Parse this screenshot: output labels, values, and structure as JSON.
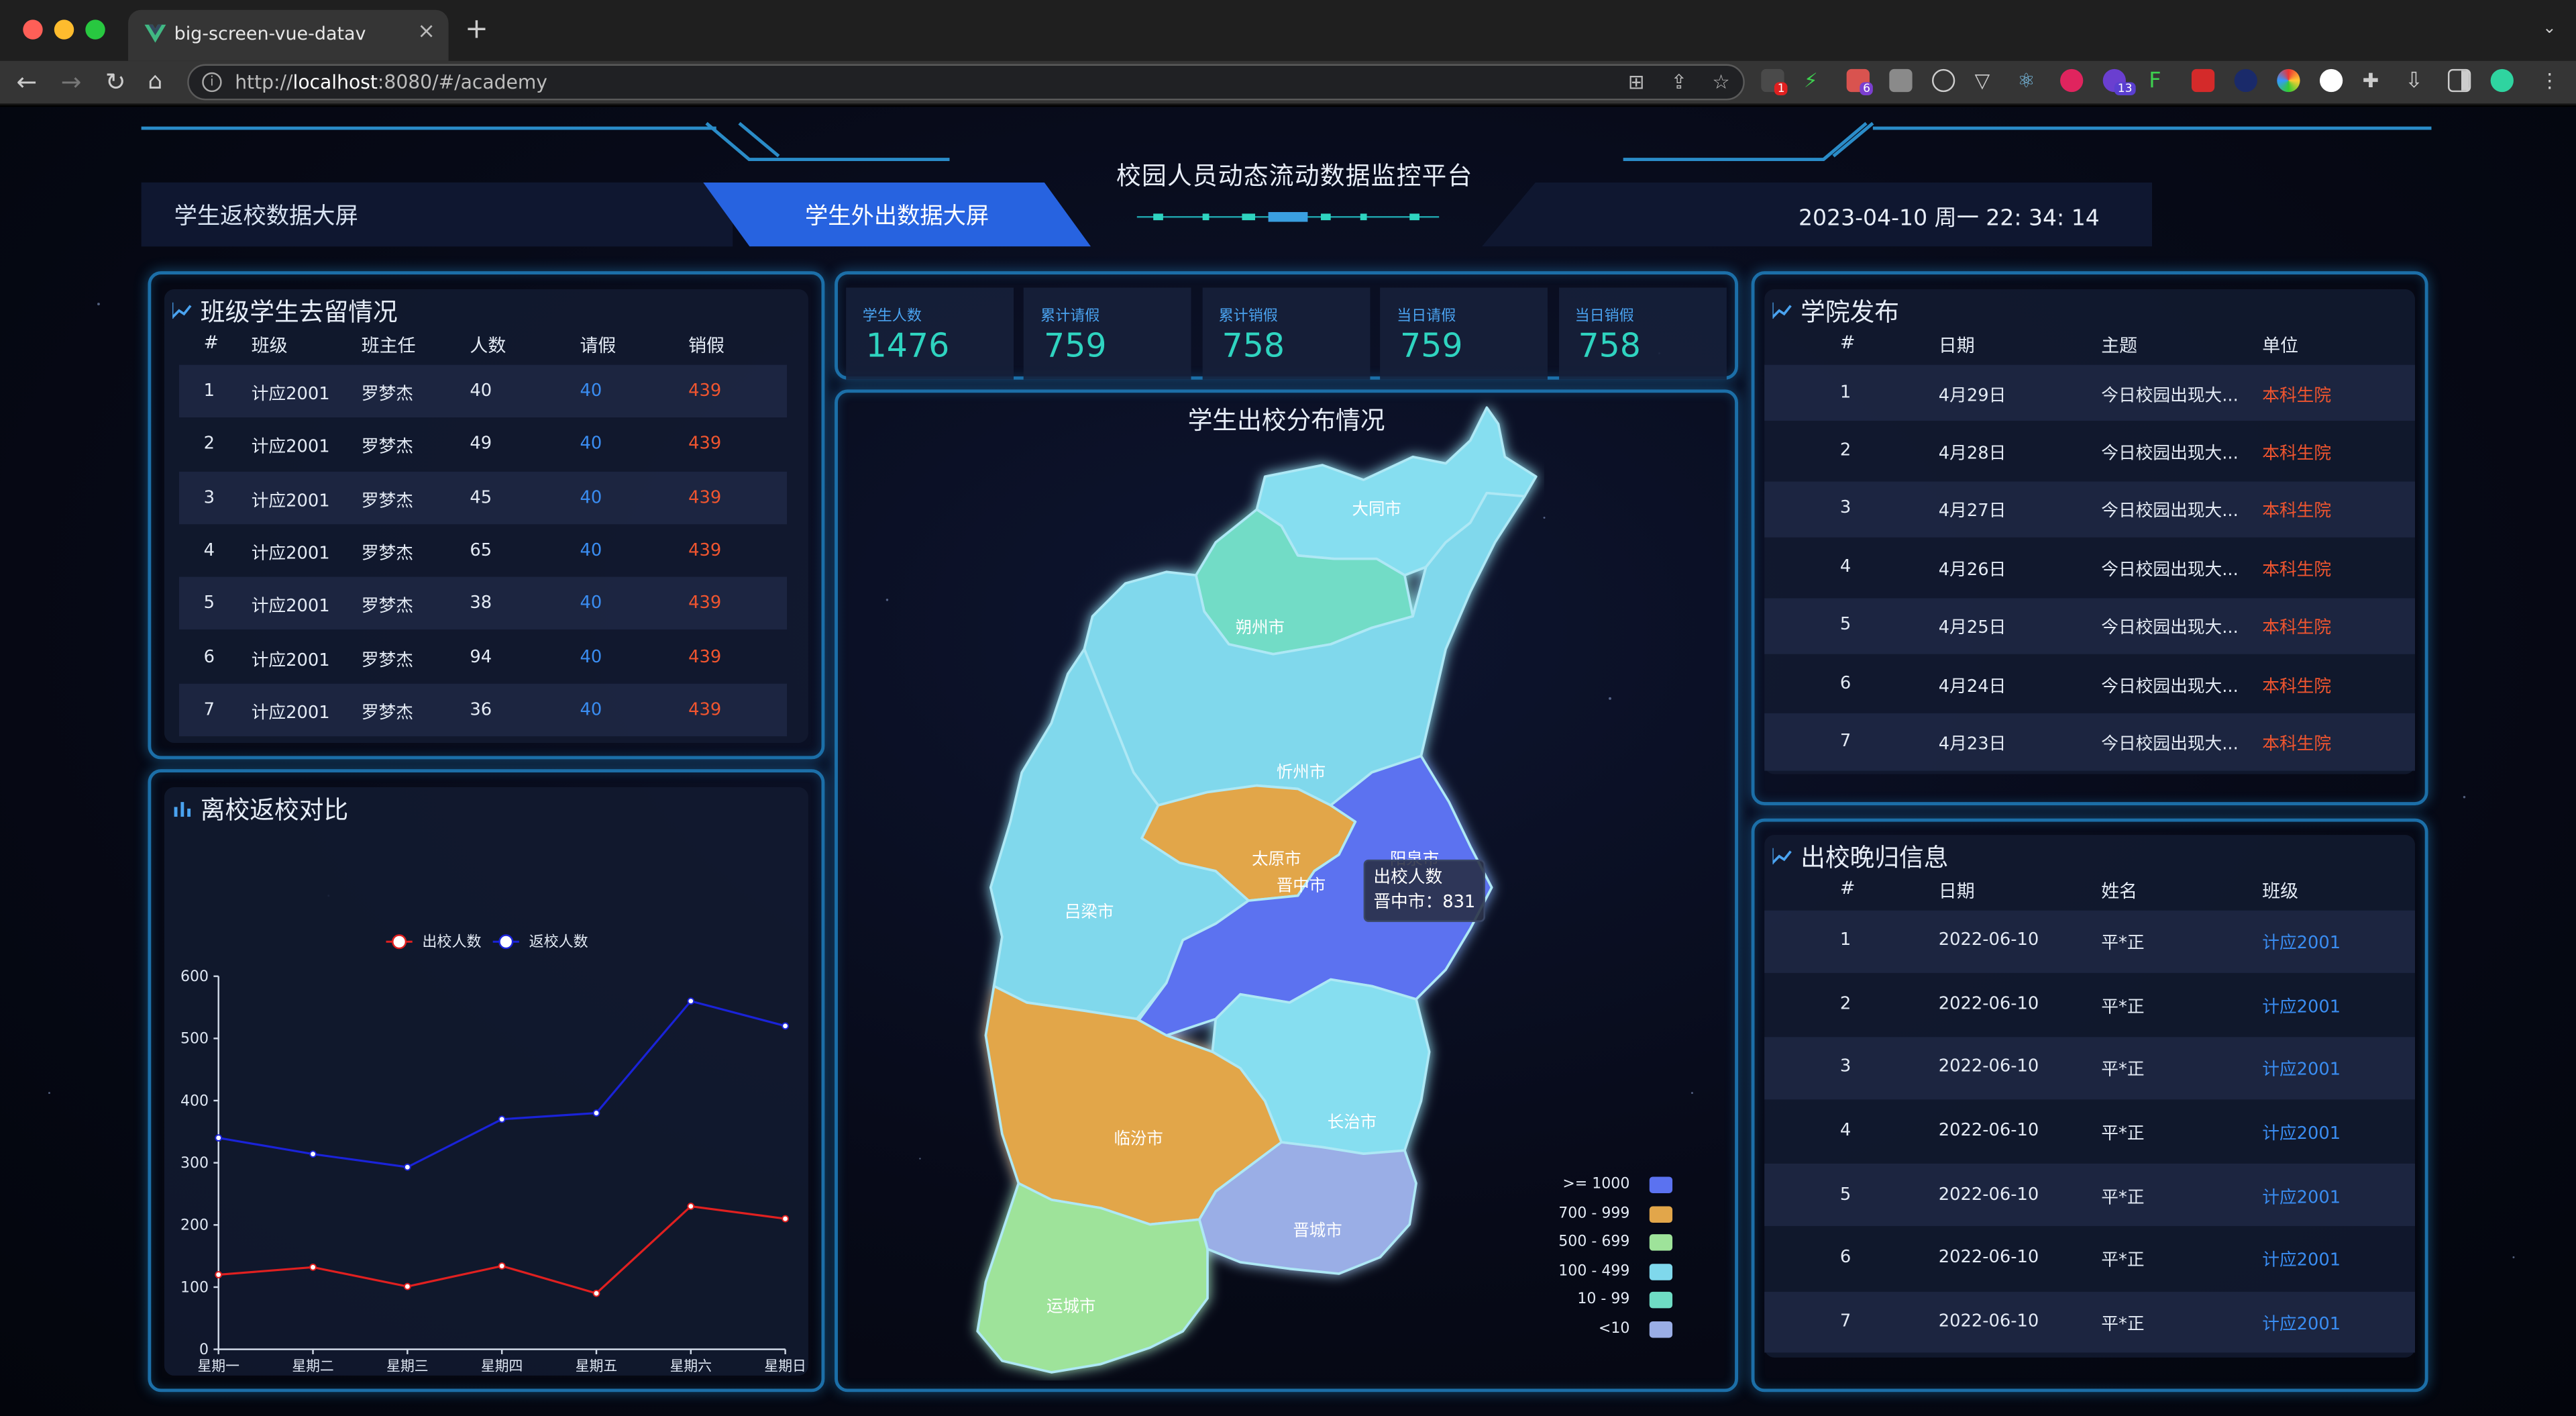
{
  "browser": {
    "tab_title": "big-screen-vue-datav",
    "tab_close": "×",
    "new_tab": "+",
    "url_prefix": "http://",
    "url_host": "localhost",
    "url_rest": ":8080/#/academy",
    "badges": [
      "1",
      "6",
      "13"
    ]
  },
  "header": {
    "title": "校园人员动态流动数据监控平台",
    "nav": [
      "学生返校数据大屏",
      "学生外出数据大屏"
    ],
    "active_nav": 1,
    "datetime": "2023-04-10 周一 22: 34: 14"
  },
  "class_panel": {
    "title": "班级学生去留情况",
    "columns": [
      "#",
      "班级",
      "班主任",
      "人数",
      "请假",
      "销假"
    ],
    "rows": [
      [
        "1",
        "计应2001",
        "罗梦杰",
        "40",
        "40",
        "439"
      ],
      [
        "2",
        "计应2001",
        "罗梦杰",
        "49",
        "40",
        "439"
      ],
      [
        "3",
        "计应2001",
        "罗梦杰",
        "45",
        "40",
        "439"
      ],
      [
        "4",
        "计应2001",
        "罗梦杰",
        "65",
        "40",
        "439"
      ],
      [
        "5",
        "计应2001",
        "罗梦杰",
        "38",
        "40",
        "439"
      ],
      [
        "6",
        "计应2001",
        "罗梦杰",
        "94",
        "40",
        "439"
      ],
      [
        "7",
        "计应2001",
        "罗梦杰",
        "36",
        "40",
        "439"
      ]
    ]
  },
  "stats": [
    {
      "label": "学生人数",
      "value": "1476"
    },
    {
      "label": "累计请假",
      "value": "759"
    },
    {
      "label": "累计销假",
      "value": "758"
    },
    {
      "label": "当日请假",
      "value": "759"
    },
    {
      "label": "当日销假",
      "value": "758"
    }
  ],
  "map_panel": {
    "title": "学生出校分布情况",
    "tooltip": {
      "title": "出校人数",
      "line": "晋中市：831"
    },
    "legend": [
      {
        "label": ">= 1000",
        "color": "#5b72f0"
      },
      {
        "label": "700 - 999",
        "color": "#e2a64a"
      },
      {
        "label": "500 - 699",
        "color": "#9ee39a"
      },
      {
        "label": "100 - 499",
        "color": "#7fd8ec"
      },
      {
        "label": "10 - 99",
        "color": "#6fdcc4"
      },
      {
        "label": "<10",
        "color": "#9aaee6"
      }
    ],
    "cities": [
      {
        "name": "大同市",
        "color": "#86def0"
      },
      {
        "name": "朔州市",
        "color": "#72dcc6"
      },
      {
        "name": "忻州市",
        "color": "#80d8ec"
      },
      {
        "name": "太原市",
        "color": "#e2a64a"
      },
      {
        "name": "阳泉市",
        "color": "#5b72f0"
      },
      {
        "name": "晋中市",
        "color": "#5b72f0"
      },
      {
        "name": "吕梁市",
        "color": "#80d8ec"
      },
      {
        "name": "长治市",
        "color": "#86def0"
      },
      {
        "name": "临汾市",
        "color": "#e2a64a"
      },
      {
        "name": "晋城市",
        "color": "#9aaee6"
      },
      {
        "name": "运城市",
        "color": "#9ee39a"
      }
    ]
  },
  "line_panel": {
    "title": "离校返校对比",
    "chart_data": {
      "type": "line",
      "categories": [
        "星期一",
        "星期二",
        "星期三",
        "星期四",
        "星期五",
        "星期六",
        "星期日"
      ],
      "series": [
        {
          "name": "出校人数",
          "color": "#e02020",
          "values": [
            120,
            132,
            101,
            134,
            90,
            230,
            210
          ]
        },
        {
          "name": "返校人数",
          "color": "#1a23d8",
          "values": [
            340,
            314,
            293,
            370,
            380,
            560,
            520
          ]
        }
      ],
      "ylim": [
        0,
        600
      ],
      "yticks": [
        "600",
        "500",
        "400",
        "300",
        "200",
        "100",
        "0"
      ],
      "legend_position": "top-center"
    }
  },
  "academy_panel": {
    "title": "学院发布",
    "columns": [
      "#",
      "日期",
      "主题",
      "单位"
    ],
    "rows": [
      [
        "1",
        "4月29日",
        "今日校园出现大...",
        "本科生院"
      ],
      [
        "2",
        "4月28日",
        "今日校园出现大...",
        "本科生院"
      ],
      [
        "3",
        "4月27日",
        "今日校园出现大...",
        "本科生院"
      ],
      [
        "4",
        "4月26日",
        "今日校园出现大...",
        "本科生院"
      ],
      [
        "5",
        "4月25日",
        "今日校园出现大...",
        "本科生院"
      ],
      [
        "6",
        "4月24日",
        "今日校园出现大...",
        "本科生院"
      ],
      [
        "7",
        "4月23日",
        "今日校园出现大...",
        "本科生院"
      ]
    ]
  },
  "late_panel": {
    "title": "出校晚归信息",
    "columns": [
      "#",
      "日期",
      "姓名",
      "班级"
    ],
    "rows": [
      [
        "1",
        "2022-06-10",
        "平*正",
        "计应2001"
      ],
      [
        "2",
        "2022-06-10",
        "平*正",
        "计应2001"
      ],
      [
        "3",
        "2022-06-10",
        "平*正",
        "计应2001"
      ],
      [
        "4",
        "2022-06-10",
        "平*正",
        "计应2001"
      ],
      [
        "5",
        "2022-06-10",
        "平*正",
        "计应2001"
      ],
      [
        "6",
        "2022-06-10",
        "平*正",
        "计应2001"
      ],
      [
        "7",
        "2022-06-10",
        "平*正",
        "计应2001"
      ]
    ]
  }
}
